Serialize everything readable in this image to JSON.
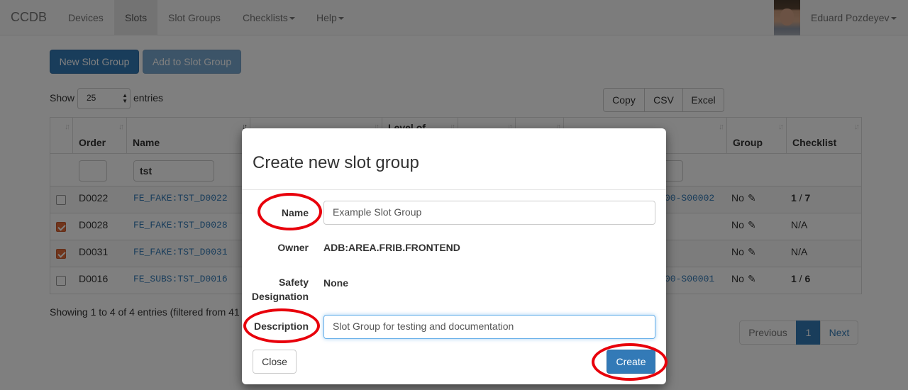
{
  "navbar": {
    "brand": "CCDB",
    "items": [
      {
        "label": "Devices"
      },
      {
        "label": "Slots"
      },
      {
        "label": "Slot Groups"
      },
      {
        "label": "Checklists"
      },
      {
        "label": "Help"
      }
    ],
    "user_name": "Eduard Pozdeyev"
  },
  "toolbar": {
    "new_group_label": "New Slot Group",
    "add_to_group_label": "Add to Slot Group"
  },
  "length_control": {
    "show_label": "Show",
    "value": "25",
    "entries_label": "entries"
  },
  "export_buttons": {
    "copy": "Copy",
    "csv": "CSV",
    "excel": "Excel"
  },
  "table": {
    "headers": {
      "order": "Order",
      "name": "Name",
      "level_partial": "Level of",
      "group": "Group",
      "checklist": "Checklist"
    },
    "filter_name_value": "tst",
    "rows": [
      {
        "checked": false,
        "order": "D0022",
        "name": "FE_FAKE:TST_D0022",
        "slot_ref": "00-S00002",
        "group": "No",
        "checklist_done": "1",
        "checklist_sep": " / ",
        "checklist_total": "7"
      },
      {
        "checked": true,
        "order": "D0028",
        "name": "FE_FAKE:TST_D0028",
        "slot_ref": "",
        "group": "No",
        "checklist_na": "N/A"
      },
      {
        "checked": true,
        "order": "D0031",
        "name": "FE_FAKE:TST_D0031",
        "slot_ref": "",
        "group": "No",
        "checklist_na": "N/A"
      },
      {
        "checked": false,
        "order": "D0016",
        "name": "FE_SUBS:TST_D0016",
        "slot_ref": "00-S00001",
        "group": "No",
        "checklist_done": "1",
        "checklist_sep": " / ",
        "checklist_total": "6"
      }
    ],
    "info": "Showing 1 to 4 of 4 entries (filtered from 41"
  },
  "pagination": {
    "previous": "Previous",
    "page": "1",
    "next": "Next"
  },
  "modal": {
    "title": "Create new slot group",
    "name_label": "Name",
    "name_value": "Example Slot Group",
    "owner_label": "Owner",
    "owner_value": "ADB:AREA.FRIB.FRONTEND",
    "safety_label_line1": "Safety",
    "safety_label_line2": "Designation",
    "safety_value": "None",
    "description_label": "Description",
    "description_value": "Slot Group for testing and documentation",
    "close_label": "Close",
    "create_label": "Create"
  },
  "colors": {
    "primary": "#337ab7",
    "annotation_ring": "#e8000b",
    "checkbox_checked": "#e06a38"
  }
}
